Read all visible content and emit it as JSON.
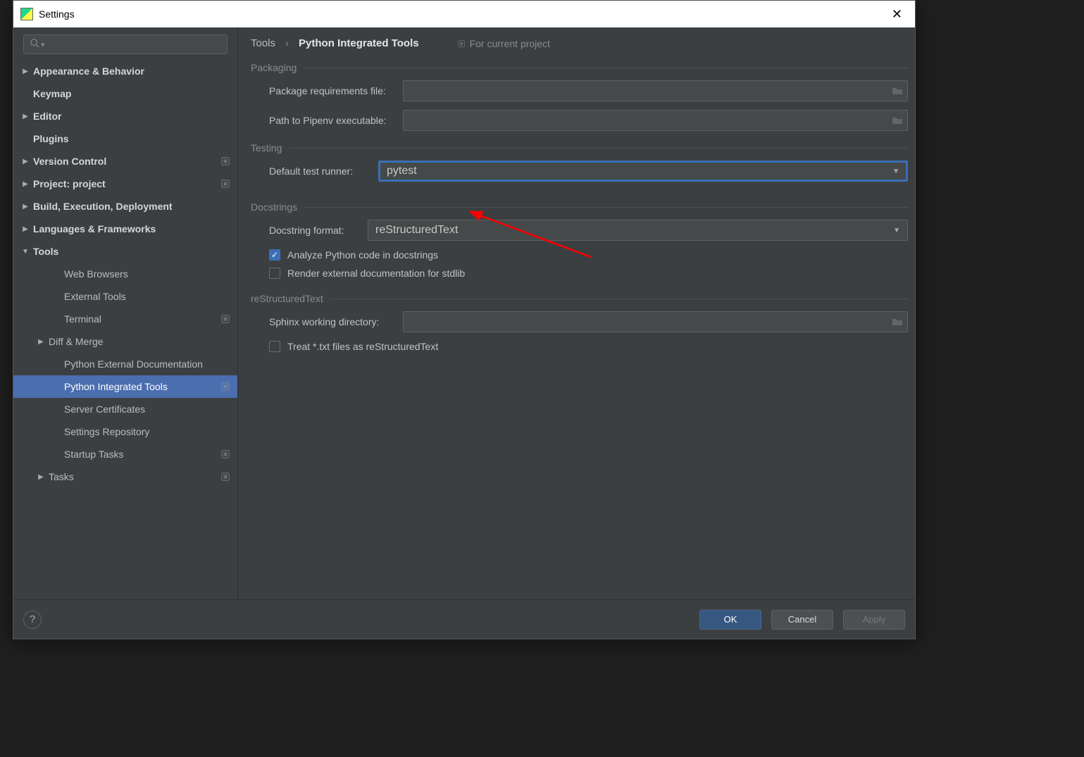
{
  "window": {
    "title": "Settings"
  },
  "sidebar": {
    "items": [
      {
        "label": "Appearance & Behavior",
        "bold": true,
        "arrow": "closed",
        "indent": 0
      },
      {
        "label": "Keymap",
        "bold": true,
        "arrow": "",
        "indent": 0
      },
      {
        "label": "Editor",
        "bold": true,
        "arrow": "closed",
        "indent": 0
      },
      {
        "label": "Plugins",
        "bold": true,
        "arrow": "",
        "indent": 0
      },
      {
        "label": "Version Control",
        "bold": true,
        "arrow": "closed",
        "indent": 0,
        "scope": true
      },
      {
        "label": "Project: project",
        "bold": true,
        "arrow": "closed",
        "indent": 0,
        "scope": true
      },
      {
        "label": "Build, Execution, Deployment",
        "bold": true,
        "arrow": "closed",
        "indent": 0
      },
      {
        "label": "Languages & Frameworks",
        "bold": true,
        "arrow": "closed",
        "indent": 0
      },
      {
        "label": "Tools",
        "bold": true,
        "arrow": "open",
        "indent": 0
      },
      {
        "label": "Web Browsers",
        "bold": false,
        "arrow": "",
        "indent": 2
      },
      {
        "label": "External Tools",
        "bold": false,
        "arrow": "",
        "indent": 2
      },
      {
        "label": "Terminal",
        "bold": false,
        "arrow": "",
        "indent": 2,
        "scope": true
      },
      {
        "label": "Diff & Merge",
        "bold": false,
        "arrow": "closed",
        "indent": 1
      },
      {
        "label": "Python External Documentation",
        "bold": false,
        "arrow": "",
        "indent": 2
      },
      {
        "label": "Python Integrated Tools",
        "bold": false,
        "arrow": "",
        "indent": 2,
        "selected": true,
        "scope": true
      },
      {
        "label": "Server Certificates",
        "bold": false,
        "arrow": "",
        "indent": 2
      },
      {
        "label": "Settings Repository",
        "bold": false,
        "arrow": "",
        "indent": 2
      },
      {
        "label": "Startup Tasks",
        "bold": false,
        "arrow": "",
        "indent": 2,
        "scope": true
      },
      {
        "label": "Tasks",
        "bold": false,
        "arrow": "closed",
        "indent": 1,
        "scope": true
      }
    ]
  },
  "breadcrumbs": {
    "root": "Tools",
    "leaf": "Python Integrated Tools",
    "scope": "For current project"
  },
  "sections": {
    "packaging": {
      "title": "Packaging",
      "req_label": "Package requirements file:",
      "req_value": "",
      "pipenv_label": "Path to Pipenv executable:",
      "pipenv_value": ""
    },
    "testing": {
      "title": "Testing",
      "runner_label": "Default test runner:",
      "runner_value": "pytest"
    },
    "docstrings": {
      "title": "Docstrings",
      "format_label": "Docstring format:",
      "format_value": "reStructuredText",
      "analyze_label": "Analyze Python code in docstrings",
      "analyze_checked": true,
      "render_label": "Render external documentation for stdlib",
      "render_checked": false
    },
    "rst": {
      "title": "reStructuredText",
      "sphinx_label": "Sphinx working directory:",
      "sphinx_value": "",
      "treat_label": "Treat *.txt files as reStructuredText",
      "treat_checked": false
    }
  },
  "footer": {
    "ok": "OK",
    "cancel": "Cancel",
    "apply": "Apply"
  }
}
